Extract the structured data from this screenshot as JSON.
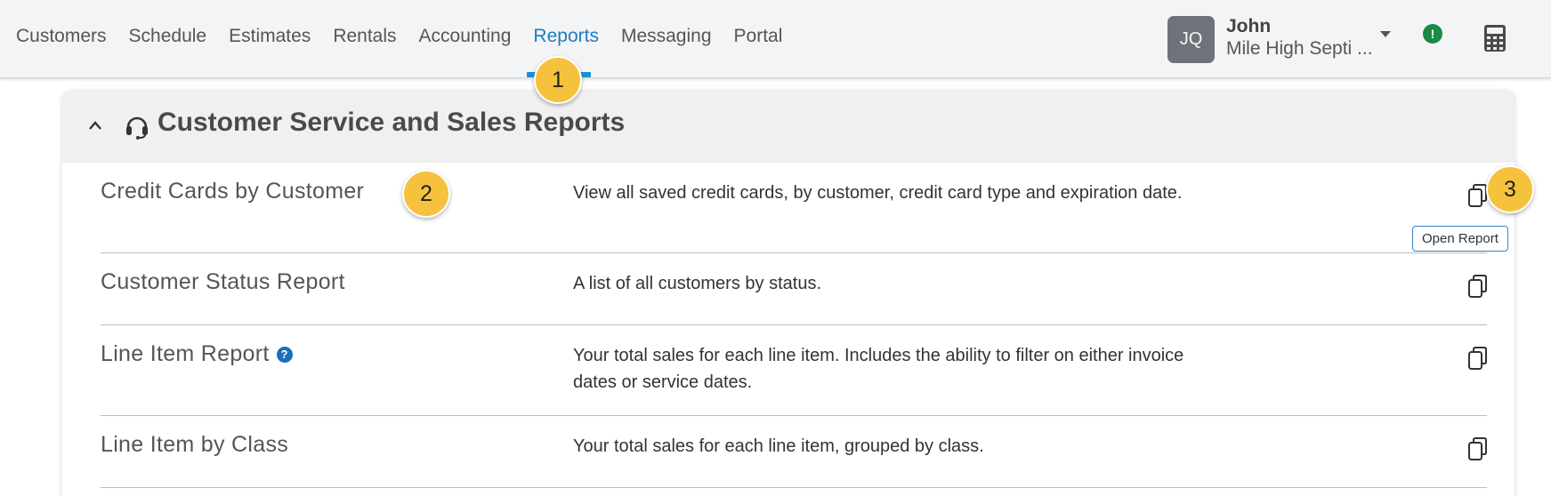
{
  "nav": {
    "items": [
      "Customers",
      "Schedule",
      "Estimates",
      "Rentals",
      "Accounting",
      "Reports",
      "Messaging",
      "Portal"
    ],
    "active_index": 5
  },
  "user": {
    "initials": "JQ",
    "name": "John",
    "company": "Mile High Septi ..."
  },
  "alert": {
    "glyph": "!"
  },
  "section": {
    "title": "Customer Service and Sales Reports"
  },
  "reports": [
    {
      "name": "Credit Cards by Customer",
      "desc": "View all saved credit cards, by customer, credit card type and expiration date."
    },
    {
      "name": "Customer Status Report",
      "desc": "A list of all customers by status."
    },
    {
      "name": "Line Item Report",
      "desc": "Your total sales for each line item. Includes the ability to filter on either invoice dates or service dates.",
      "help": "?"
    },
    {
      "name": "Line Item by Class",
      "desc": "Your total sales for each line item, grouped by class."
    }
  ],
  "tooltip": {
    "text": "Open Report"
  },
  "steps": [
    "1",
    "2",
    "3"
  ],
  "colors": {
    "accent": "#1b7ec2",
    "step": "#f6c23e",
    "alert": "#1a8a45"
  }
}
